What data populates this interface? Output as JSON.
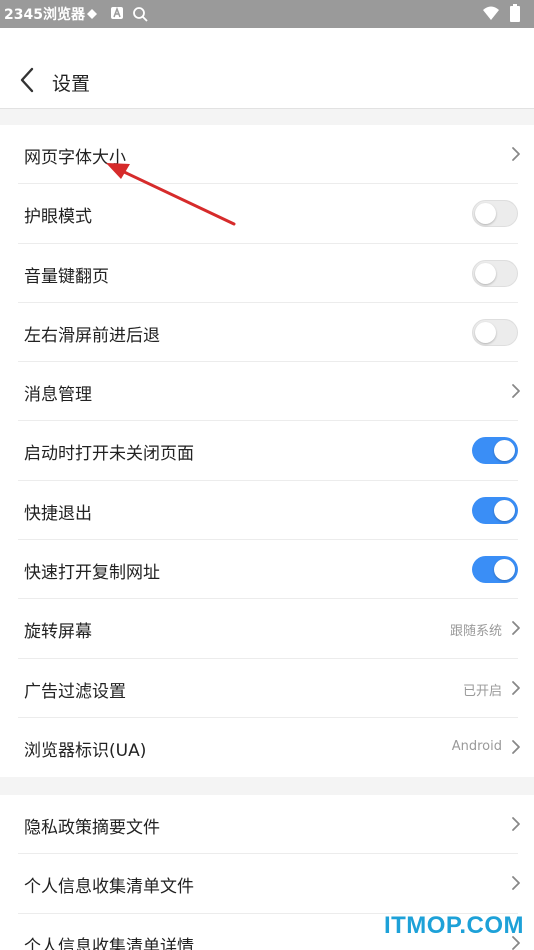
{
  "status_bar": {
    "app_name": "2345浏览器",
    "icons": [
      "notification-icon",
      "a-icon",
      "search-icon",
      "wifi-icon",
      "battery-icon"
    ]
  },
  "header": {
    "back_icon": "back-arrow-icon",
    "title": "设置"
  },
  "group1": [
    {
      "label": "网页字体大小",
      "type": "chevron"
    },
    {
      "label": "护眼模式",
      "type": "toggle",
      "on": false
    },
    {
      "label": "音量键翻页",
      "type": "toggle",
      "on": false
    },
    {
      "label": "左右滑屏前进后退",
      "type": "toggle",
      "on": false
    },
    {
      "label": "消息管理",
      "type": "chevron"
    },
    {
      "label": "启动时打开未关闭页面",
      "type": "toggle",
      "on": true
    },
    {
      "label": "快捷退出",
      "type": "toggle",
      "on": true
    },
    {
      "label": "快速打开复制网址",
      "type": "toggle",
      "on": true
    },
    {
      "label": "旋转屏幕",
      "type": "chevron",
      "value": "跟随系统"
    },
    {
      "label": "广告过滤设置",
      "type": "chevron",
      "value": "已开启"
    },
    {
      "label": "浏览器标识(UA)",
      "type": "chevron",
      "value": "Android"
    }
  ],
  "group2": [
    {
      "label": "隐私政策摘要文件",
      "type": "chevron"
    },
    {
      "label": "个人信息收集清单文件",
      "type": "chevron"
    },
    {
      "label": "个人信息收集清单详情",
      "type": "chevron"
    }
  ],
  "colors": {
    "accent": "#3a8ef6",
    "status_bar": "#9a9a9a",
    "annotation_arrow": "#d62b2b",
    "watermark": "#1da1d8"
  },
  "watermark": "ITMOP.COM"
}
